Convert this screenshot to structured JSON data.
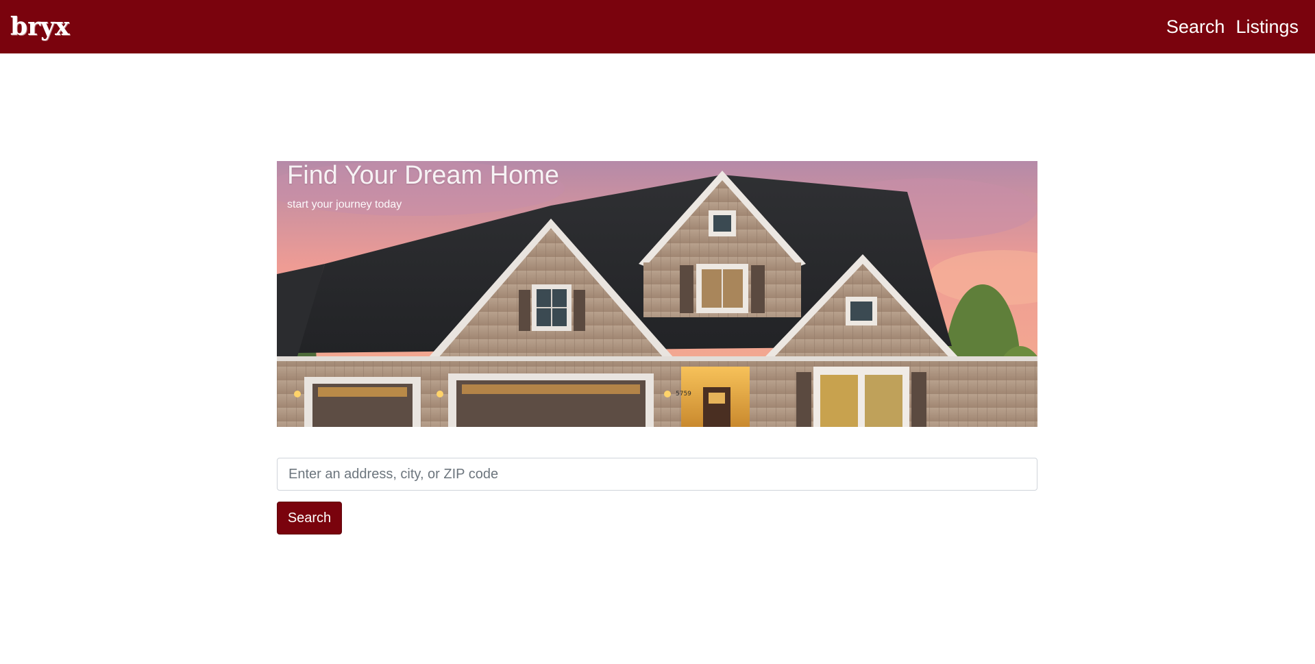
{
  "navbar": {
    "brand": "bryx",
    "links": [
      {
        "label": "Search"
      },
      {
        "label": "Listings"
      }
    ],
    "color": "#7a030d"
  },
  "hero": {
    "title": "Find Your Dream Home",
    "subtitle": "start your journey today",
    "house_number": "5759"
  },
  "search": {
    "placeholder": "Enter an address, city, or ZIP code",
    "value": "",
    "button_label": "Search"
  }
}
